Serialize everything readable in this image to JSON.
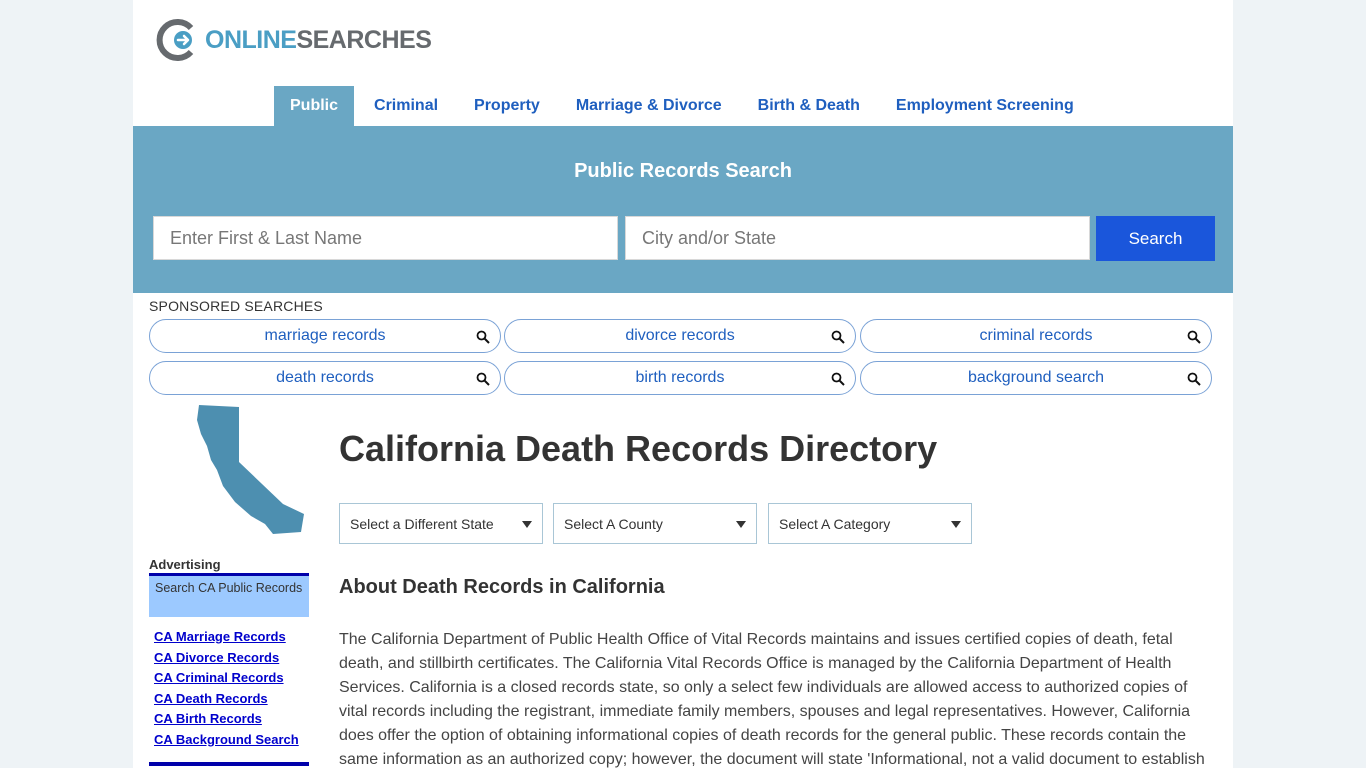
{
  "brand": {
    "part1": "ONLINE",
    "part2": "SEARCHES"
  },
  "colors": {
    "accent": "#6aa7c4",
    "link": "#1f5fbf",
    "button": "#1a56db",
    "brand_blue": "#4a9ec4",
    "brand_gray": "#666a6e",
    "sidebar_box": "#9cc9ff"
  },
  "nav": [
    {
      "label": "Public",
      "active": true
    },
    {
      "label": "Criminal"
    },
    {
      "label": "Property"
    },
    {
      "label": "Marriage & Divorce"
    },
    {
      "label": "Birth & Death"
    },
    {
      "label": "Employment Screening"
    }
  ],
  "hero": {
    "title": "Public Records Search",
    "name_placeholder": "Enter First & Last Name",
    "location_placeholder": "City and/or State",
    "search_label": "Search"
  },
  "sponsored": {
    "label": "SPONSORED SEARCHES",
    "items": [
      {
        "label": "marriage records",
        "icon": "search-icon"
      },
      {
        "label": "divorce records",
        "icon": "search-icon"
      },
      {
        "label": "criminal records",
        "icon": "search-icon"
      },
      {
        "label": "death records",
        "icon": "search-icon"
      },
      {
        "label": "birth records",
        "icon": "search-icon"
      },
      {
        "label": "background search",
        "icon": "search-icon"
      }
    ]
  },
  "sidebar": {
    "map_icon": "california-map-icon",
    "advertising_label": "Advertising",
    "ad_box_text": "Search CA Public Records",
    "links": [
      "CA Marriage Records",
      "CA Divorce Records",
      "CA Criminal Records",
      "CA Death Records",
      "CA Birth Records",
      "CA Background Search"
    ]
  },
  "main": {
    "title": "California Death Records Directory",
    "selects": [
      {
        "label": "Select a Different State"
      },
      {
        "label": "Select A County"
      },
      {
        "label": "Select A Category"
      }
    ],
    "section_title": "About Death Records in California",
    "body": "The California Department of Public Health Office of Vital Records maintains and issues certified copies of death, fetal death, and stillbirth certificates. The California Vital Records Office is managed by the California Department of Health Services. California is a closed records state, so only a select few individuals are allowed access to authorized copies of vital records including the registrant, immediate family members, spouses and legal representatives. However, California does offer the option of obtaining informational copies of death records for the general public. These records contain the same information as an authorized copy; however, the document will state 'Informational, not a valid document to establish"
  }
}
